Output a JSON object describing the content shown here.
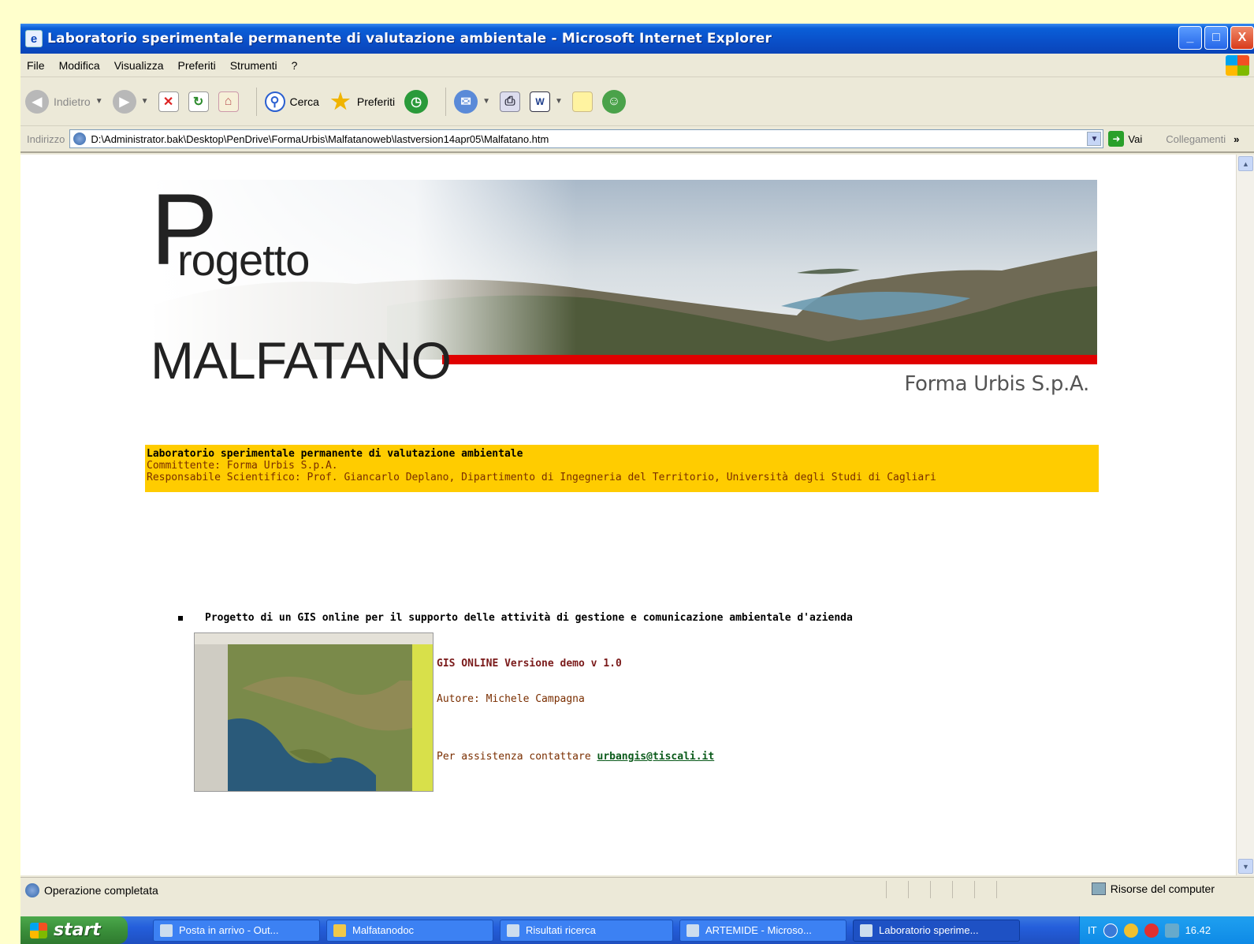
{
  "window": {
    "title": "Laboratorio sperimentale permanente di valutazione ambientale - Microsoft Internet Explorer",
    "buttons": {
      "minimize": "_",
      "maximize": "□",
      "close": "X"
    }
  },
  "menu": [
    "File",
    "Modifica",
    "Visualizza",
    "Preferiti",
    "Strumenti",
    "?"
  ],
  "toolbar": {
    "back": "Indietro",
    "search": "Cerca",
    "favorites": "Preferiti"
  },
  "address": {
    "label": "Indirizzo",
    "url": "D:\\Administrator.bak\\Desktop\\PenDrive\\FormaUrbis\\Malfatanoweb\\lastversion14apr05\\Malfatano.htm",
    "go": "Vai",
    "links": "Collegamenti",
    "links_more": "»"
  },
  "page": {
    "logo_p": "P",
    "logo_rogetto": "rogetto",
    "logo_malfatano": "MALFATANO",
    "company": "Forma Urbis S.p.A.",
    "band_line1": "Laboratorio sperimentale permanente di valutazione ambientale",
    "band_line2": "Committente: Forma Urbis S.p.A.",
    "band_line3": "Responsabile Scientifico: Prof. Giancarlo Deplano, Dipartimento di Ingegneria del Territorio, Università degli Studi di Cagliari",
    "bullet": "Progetto di un GIS online per il supporto delle attività di gestione e comunicazione ambientale d'azienda",
    "gis_title": "GIS ONLINE Versione demo v 1.0",
    "gis_author": "Autore: Michele Campagna",
    "gis_contact_prefix": "Per assistenza contattare ",
    "gis_contact_email": "urbangis@tiscali.it"
  },
  "status": {
    "text": "Operazione completata",
    "zone": "Risorse del computer"
  },
  "taskbar": {
    "start": "start",
    "tasks": [
      "Posta in arrivo - Out...",
      "Malfatanodoc",
      "Risultati ricerca",
      "ARTEMIDE - Microso...",
      "Laboratorio sperime..."
    ],
    "lang": "IT",
    "clock": "16.42"
  },
  "colors": {
    "page_bg": "#ffffcc",
    "band": "#ffcc00",
    "red_bar": "#e00000",
    "titlebar": "#0a4fc8"
  }
}
